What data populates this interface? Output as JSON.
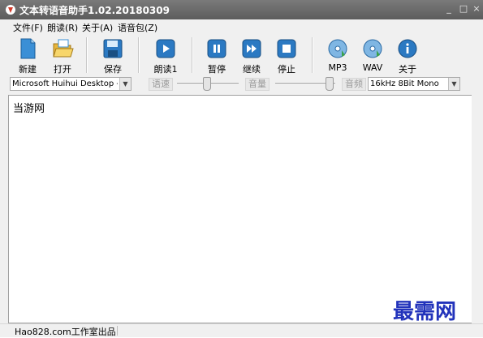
{
  "window": {
    "title": "文本转语音助手1.02.20180309",
    "controls": {
      "minimize": "_",
      "maximize": "□",
      "close": "×"
    }
  },
  "menu": {
    "items": [
      {
        "label": "文件(F)"
      },
      {
        "label": "朗读(R)"
      },
      {
        "label": "关于(A)"
      },
      {
        "label": "语音包(Z)"
      }
    ]
  },
  "toolbar": {
    "new": "新建",
    "open": "打开",
    "save": "保存",
    "read": "朗读1",
    "pause": "暂停",
    "resume": "继续",
    "stop": "停止",
    "mp3": "MP3",
    "wav": "WAV",
    "about": "关于"
  },
  "options": {
    "voice": "Microsoft Huihui Desktop - Chinese",
    "speed_label": "语速",
    "speed_level": 0.5,
    "volume_label": "音量",
    "volume_level": 1.0,
    "frequency_label": "音频",
    "format": "16kHz 8Bit Mono"
  },
  "editor": {
    "text": "当游网"
  },
  "status": {
    "text": "Hao828.com工作室出品"
  },
  "watermark": "最需网",
  "colors": {
    "titlebar": "#666666",
    "icon_blue": "#2b79c2",
    "icon_yellow": "#f2c94c",
    "watermark": "#2233bb"
  }
}
